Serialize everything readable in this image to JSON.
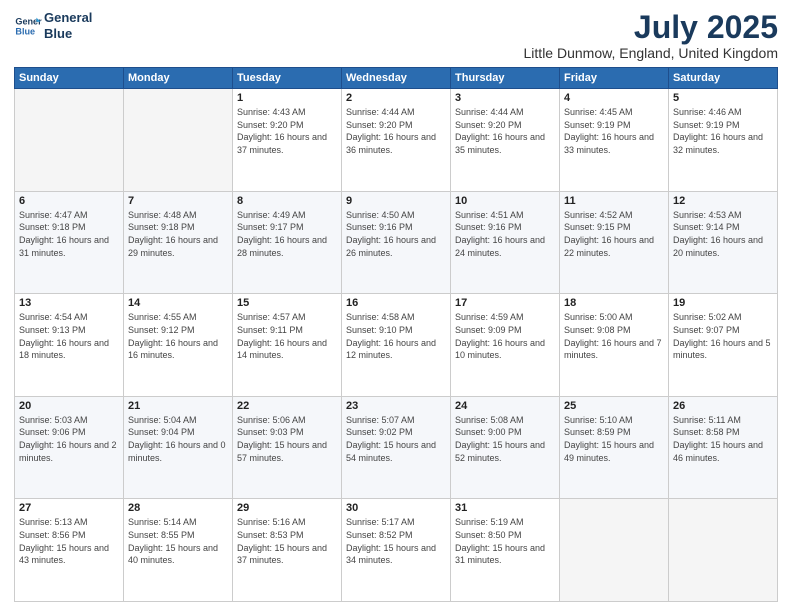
{
  "header": {
    "logo_line1": "General",
    "logo_line2": "Blue",
    "month": "July 2025",
    "location": "Little Dunmow, England, United Kingdom"
  },
  "weekdays": [
    "Sunday",
    "Monday",
    "Tuesday",
    "Wednesday",
    "Thursday",
    "Friday",
    "Saturday"
  ],
  "weeks": [
    [
      {
        "day": "",
        "sunrise": "",
        "sunset": "",
        "daylight": ""
      },
      {
        "day": "",
        "sunrise": "",
        "sunset": "",
        "daylight": ""
      },
      {
        "day": "1",
        "sunrise": "Sunrise: 4:43 AM",
        "sunset": "Sunset: 9:20 PM",
        "daylight": "Daylight: 16 hours and 37 minutes."
      },
      {
        "day": "2",
        "sunrise": "Sunrise: 4:44 AM",
        "sunset": "Sunset: 9:20 PM",
        "daylight": "Daylight: 16 hours and 36 minutes."
      },
      {
        "day": "3",
        "sunrise": "Sunrise: 4:44 AM",
        "sunset": "Sunset: 9:20 PM",
        "daylight": "Daylight: 16 hours and 35 minutes."
      },
      {
        "day": "4",
        "sunrise": "Sunrise: 4:45 AM",
        "sunset": "Sunset: 9:19 PM",
        "daylight": "Daylight: 16 hours and 33 minutes."
      },
      {
        "day": "5",
        "sunrise": "Sunrise: 4:46 AM",
        "sunset": "Sunset: 9:19 PM",
        "daylight": "Daylight: 16 hours and 32 minutes."
      }
    ],
    [
      {
        "day": "6",
        "sunrise": "Sunrise: 4:47 AM",
        "sunset": "Sunset: 9:18 PM",
        "daylight": "Daylight: 16 hours and 31 minutes."
      },
      {
        "day": "7",
        "sunrise": "Sunrise: 4:48 AM",
        "sunset": "Sunset: 9:18 PM",
        "daylight": "Daylight: 16 hours and 29 minutes."
      },
      {
        "day": "8",
        "sunrise": "Sunrise: 4:49 AM",
        "sunset": "Sunset: 9:17 PM",
        "daylight": "Daylight: 16 hours and 28 minutes."
      },
      {
        "day": "9",
        "sunrise": "Sunrise: 4:50 AM",
        "sunset": "Sunset: 9:16 PM",
        "daylight": "Daylight: 16 hours and 26 minutes."
      },
      {
        "day": "10",
        "sunrise": "Sunrise: 4:51 AM",
        "sunset": "Sunset: 9:16 PM",
        "daylight": "Daylight: 16 hours and 24 minutes."
      },
      {
        "day": "11",
        "sunrise": "Sunrise: 4:52 AM",
        "sunset": "Sunset: 9:15 PM",
        "daylight": "Daylight: 16 hours and 22 minutes."
      },
      {
        "day": "12",
        "sunrise": "Sunrise: 4:53 AM",
        "sunset": "Sunset: 9:14 PM",
        "daylight": "Daylight: 16 hours and 20 minutes."
      }
    ],
    [
      {
        "day": "13",
        "sunrise": "Sunrise: 4:54 AM",
        "sunset": "Sunset: 9:13 PM",
        "daylight": "Daylight: 16 hours and 18 minutes."
      },
      {
        "day": "14",
        "sunrise": "Sunrise: 4:55 AM",
        "sunset": "Sunset: 9:12 PM",
        "daylight": "Daylight: 16 hours and 16 minutes."
      },
      {
        "day": "15",
        "sunrise": "Sunrise: 4:57 AM",
        "sunset": "Sunset: 9:11 PM",
        "daylight": "Daylight: 16 hours and 14 minutes."
      },
      {
        "day": "16",
        "sunrise": "Sunrise: 4:58 AM",
        "sunset": "Sunset: 9:10 PM",
        "daylight": "Daylight: 16 hours and 12 minutes."
      },
      {
        "day": "17",
        "sunrise": "Sunrise: 4:59 AM",
        "sunset": "Sunset: 9:09 PM",
        "daylight": "Daylight: 16 hours and 10 minutes."
      },
      {
        "day": "18",
        "sunrise": "Sunrise: 5:00 AM",
        "sunset": "Sunset: 9:08 PM",
        "daylight": "Daylight: 16 hours and 7 minutes."
      },
      {
        "day": "19",
        "sunrise": "Sunrise: 5:02 AM",
        "sunset": "Sunset: 9:07 PM",
        "daylight": "Daylight: 16 hours and 5 minutes."
      }
    ],
    [
      {
        "day": "20",
        "sunrise": "Sunrise: 5:03 AM",
        "sunset": "Sunset: 9:06 PM",
        "daylight": "Daylight: 16 hours and 2 minutes."
      },
      {
        "day": "21",
        "sunrise": "Sunrise: 5:04 AM",
        "sunset": "Sunset: 9:04 PM",
        "daylight": "Daylight: 16 hours and 0 minutes."
      },
      {
        "day": "22",
        "sunrise": "Sunrise: 5:06 AM",
        "sunset": "Sunset: 9:03 PM",
        "daylight": "Daylight: 15 hours and 57 minutes."
      },
      {
        "day": "23",
        "sunrise": "Sunrise: 5:07 AM",
        "sunset": "Sunset: 9:02 PM",
        "daylight": "Daylight: 15 hours and 54 minutes."
      },
      {
        "day": "24",
        "sunrise": "Sunrise: 5:08 AM",
        "sunset": "Sunset: 9:00 PM",
        "daylight": "Daylight: 15 hours and 52 minutes."
      },
      {
        "day": "25",
        "sunrise": "Sunrise: 5:10 AM",
        "sunset": "Sunset: 8:59 PM",
        "daylight": "Daylight: 15 hours and 49 minutes."
      },
      {
        "day": "26",
        "sunrise": "Sunrise: 5:11 AM",
        "sunset": "Sunset: 8:58 PM",
        "daylight": "Daylight: 15 hours and 46 minutes."
      }
    ],
    [
      {
        "day": "27",
        "sunrise": "Sunrise: 5:13 AM",
        "sunset": "Sunset: 8:56 PM",
        "daylight": "Daylight: 15 hours and 43 minutes."
      },
      {
        "day": "28",
        "sunrise": "Sunrise: 5:14 AM",
        "sunset": "Sunset: 8:55 PM",
        "daylight": "Daylight: 15 hours and 40 minutes."
      },
      {
        "day": "29",
        "sunrise": "Sunrise: 5:16 AM",
        "sunset": "Sunset: 8:53 PM",
        "daylight": "Daylight: 15 hours and 37 minutes."
      },
      {
        "day": "30",
        "sunrise": "Sunrise: 5:17 AM",
        "sunset": "Sunset: 8:52 PM",
        "daylight": "Daylight: 15 hours and 34 minutes."
      },
      {
        "day": "31",
        "sunrise": "Sunrise: 5:19 AM",
        "sunset": "Sunset: 8:50 PM",
        "daylight": "Daylight: 15 hours and 31 minutes."
      },
      {
        "day": "",
        "sunrise": "",
        "sunset": "",
        "daylight": ""
      },
      {
        "day": "",
        "sunrise": "",
        "sunset": "",
        "daylight": ""
      }
    ]
  ]
}
